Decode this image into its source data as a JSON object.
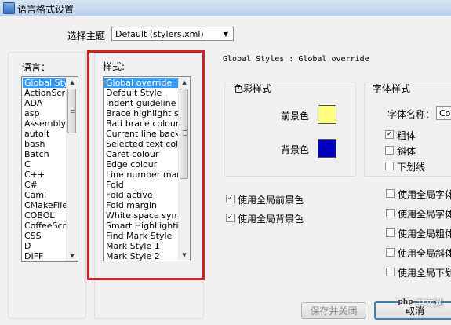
{
  "window": {
    "title": "语言格式设置"
  },
  "theme": {
    "label": "选择主题",
    "selected": "Default (stylers.xml)"
  },
  "language": {
    "label": "语言：",
    "items": [
      "Global Styles",
      "ActionScript",
      "ADA",
      "asp",
      "Assembly",
      "autoIt",
      "bash",
      "Batch",
      "C",
      "C++",
      "C#",
      "Caml",
      "CMakeFile",
      "COBOL",
      "CoffeeScript",
      "CSS",
      "D",
      "DIFF"
    ],
    "selected_index": 0
  },
  "style": {
    "label": "样式:",
    "items": [
      "Global override",
      "Default Style",
      "Indent guideline style",
      "Brace highlight style",
      "Bad brace colour",
      "Current line background colour",
      "Selected text colour",
      "Caret colour",
      "Edge colour",
      "Line number margin",
      "Fold",
      "Fold active",
      "Fold margin",
      "White space symbol",
      "Smart HighLighting",
      "Find Mark Style",
      "Mark Style 1",
      "Mark Style 2"
    ],
    "selected_index": 0
  },
  "header": {
    "text": "Global Styles : Global override"
  },
  "color_style": {
    "title": "色彩样式",
    "foreground_label": "前景色",
    "background_label": "背景色",
    "foreground_color": "#ffff80",
    "background_color": "#0000c0"
  },
  "font_style": {
    "title": "字体样式",
    "font_name_label": "字体名称：",
    "font_name_value": "Co",
    "bold_label": "粗体",
    "italic_label": "斜体",
    "underline_label": "下划线"
  },
  "global_checks": {
    "use_global_fg": "使用全局前景色",
    "use_global_bg": "使用全局背景色",
    "right": [
      "使用全局字体",
      "使用全局字体",
      "使用全局粗体",
      "使用全局斜体",
      "使用全局下划"
    ]
  },
  "buttons": {
    "save_close": "保存并关闭",
    "cancel": "取消"
  },
  "watermark": {
    "logo": "php",
    "text": "中文网"
  }
}
